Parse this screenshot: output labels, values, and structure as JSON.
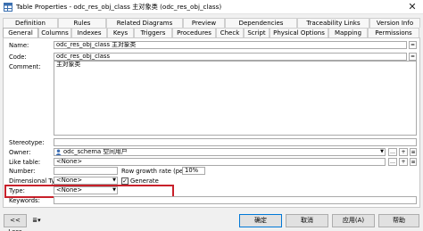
{
  "window": {
    "title": "Table Properties - odc_res_obj_class 主对象类 (odc_res_obj_class)",
    "close_glyph": "✕"
  },
  "tabs_row1": [
    "Definition",
    "Rules",
    "Related Diagrams",
    "Preview",
    "Dependencies",
    "Traceability Links",
    "Version Info"
  ],
  "tabs_row2": [
    "General",
    "Columns",
    "Indexes",
    "Keys",
    "Triggers",
    "Procedures",
    "Check",
    "Script",
    "Physical Options",
    "Mapping",
    "Permissions"
  ],
  "form": {
    "name_label": "Name:",
    "name_value": "odc_res_obj_class 主对象类",
    "code_label": "Code:",
    "code_value": "odc_res_obj_class",
    "comment_label": "Comment:",
    "comment_value": "主对象类",
    "stereotype_label": "Stereotype:",
    "stereotype_value": "",
    "owner_label": "Owner:",
    "owner_value": "odc_schema 空间用户",
    "like_label": "Like table:",
    "like_value": "<None>",
    "number_label": "Number:",
    "number_value": "",
    "growth_label": "Row growth rate (per year):",
    "growth_value": "10%",
    "dimtype_label": "Dimensional Type:",
    "dimtype_value": "<None>",
    "generate_label": "Generate",
    "generate_checked": true,
    "type_label": "Type:",
    "type_value": "<None>",
    "keywords_label": "Keywords:",
    "keywords_value": ""
  },
  "footer": {
    "less_label": "<< Less",
    "ok_label": "确定",
    "cancel_label": "取消",
    "apply_label": "应用(A)",
    "help_label": "帮助"
  },
  "colors": {
    "highlight": "#c8202a",
    "accent": "#0078d7"
  }
}
